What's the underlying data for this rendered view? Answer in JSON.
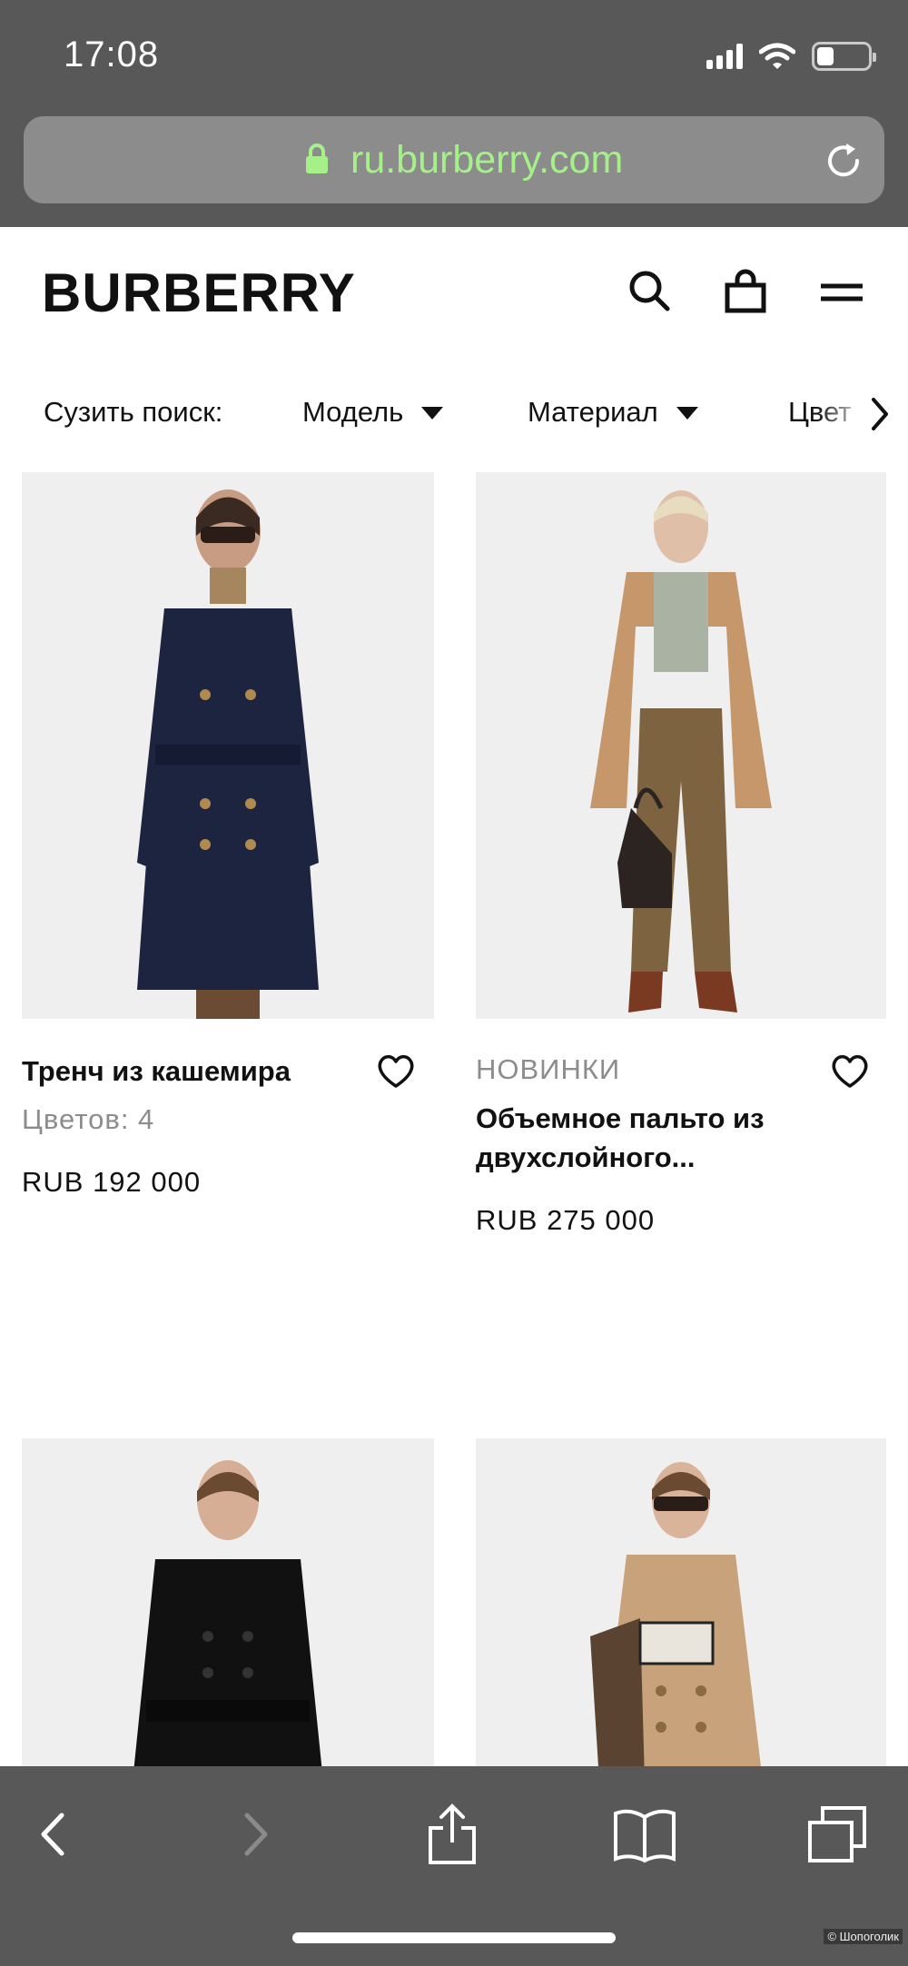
{
  "status_bar": {
    "time": "17:08",
    "battery_level_percent": 25
  },
  "browser": {
    "url": "ru.burberry.com"
  },
  "header": {
    "logo": "BURBERRY"
  },
  "filters": {
    "label": "Сузить поиск:",
    "options": [
      "Модель",
      "Материал"
    ],
    "truncated_option": "Цвет"
  },
  "products": [
    {
      "badge": "",
      "title": "Тренч из кашемира",
      "colors": "Цветов: 4",
      "price": "RUB 192 000",
      "image": "navy-trench-coat"
    },
    {
      "badge": "НОВИНКИ",
      "title": "Объемное пальто из двухслойного...",
      "colors": "",
      "price": "RUB 275 000",
      "image": "camel-coat-checked-trousers"
    },
    {
      "badge": "",
      "title": "",
      "colors": "",
      "price": "",
      "image": "black-trench-coat"
    },
    {
      "badge": "",
      "title": "",
      "colors": "",
      "price": "",
      "image": "beige-trench-coat"
    }
  ],
  "toolbar": {
    "buttons": [
      "back-icon",
      "forward-icon",
      "share-icon",
      "bookmarks-icon",
      "tabs-icon"
    ]
  },
  "watermark": "© Шопоголик",
  "colors": {
    "chrome_gray": "#585858",
    "url_green": "#a6f08a",
    "text_dark": "#111111",
    "text_muted": "#8c8c8c",
    "image_bg": "#efefef"
  }
}
